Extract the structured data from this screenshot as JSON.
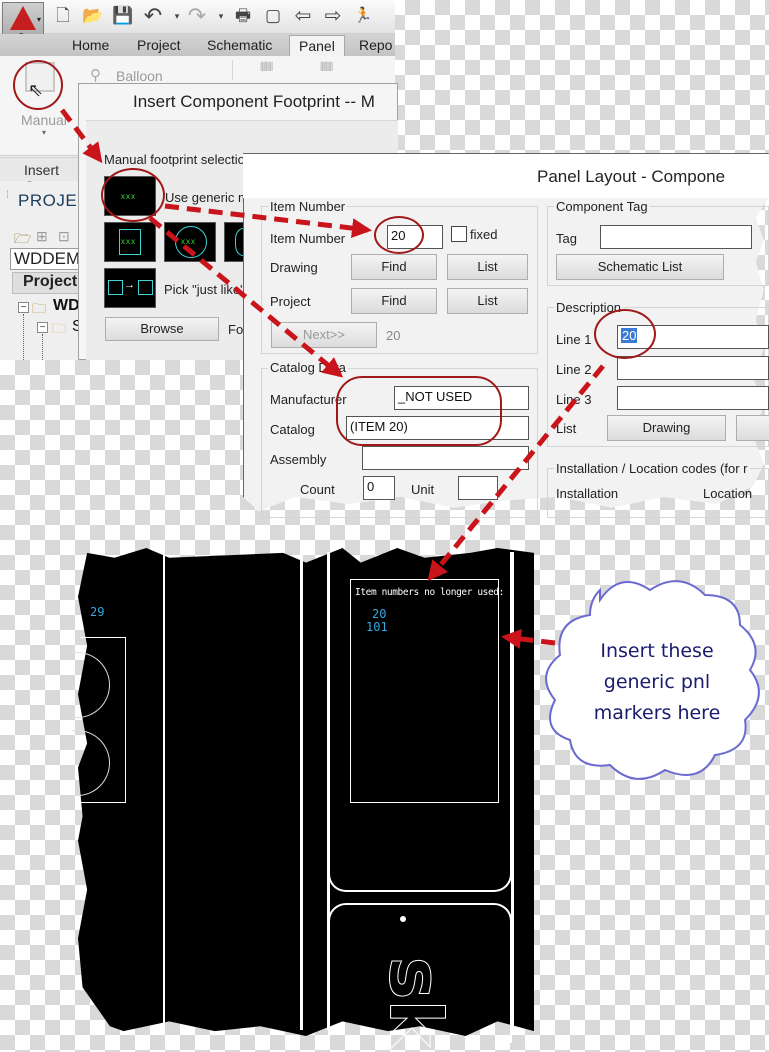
{
  "autocad": {
    "app_menu": {
      "logo": "autocad-logo",
      "sub_label": "E"
    },
    "quick_access": [
      {
        "name": "new-icon",
        "glyph": "🗋"
      },
      {
        "name": "open-icon",
        "glyph": "📂"
      },
      {
        "name": "save-icon",
        "glyph": "💾"
      },
      {
        "name": "undo-icon",
        "glyph": "↶"
      },
      {
        "name": "redo-icon",
        "glyph": "↷"
      },
      {
        "name": "print-icon",
        "glyph": "🖶"
      },
      {
        "name": "project-manager-icon",
        "glyph": "▢"
      },
      {
        "name": "back-icon",
        "glyph": "⇦"
      },
      {
        "name": "forward-icon",
        "glyph": "⇨"
      },
      {
        "name": "run-icon",
        "glyph": "🏃"
      }
    ],
    "tabs": [
      {
        "label": "Home"
      },
      {
        "label": "Project"
      },
      {
        "label": "Schematic"
      },
      {
        "label": "Panel",
        "active": true
      },
      {
        "label": "Repo"
      }
    ],
    "ribbon": {
      "manual_label": "Manual",
      "balloon_label": "Balloon",
      "panel_label": "Insert Co"
    },
    "project_pane": {
      "title": "PROJEC",
      "combo_value": "WDDEM",
      "header": "Project",
      "tree": [
        {
          "label": "WD",
          "bold": true
        },
        {
          "label": "S"
        }
      ]
    }
  },
  "footprint_dialog": {
    "title": "Insert Component Footprint -- M",
    "section_label": "Manual footprint selection or creation",
    "generic_label": "Use generic m",
    "thumb_text": "xxx",
    "pick_label": "Pick \"just like\"",
    "browse_label": "Browse",
    "fo_label": "Fo"
  },
  "panel_layout_dialog": {
    "title": "Panel Layout - Compone",
    "item_number_group": {
      "label": "Item Number",
      "item_number_label": "Item Number",
      "item_number_value": "20",
      "fixed_label": "fixed",
      "fixed_checked": false,
      "drawing_label": "Drawing",
      "project_label": "Project",
      "find_label": "Find",
      "list_label": "List",
      "next_label": "Next>>",
      "next_value": "20"
    },
    "catalog_group": {
      "label": "Catalog Data",
      "manufacturer_label": "Manufacturer",
      "manufacturer_value": "_NOT USED",
      "catalog_label": "Catalog",
      "catalog_value": "(ITEM 20)",
      "assembly_label": "Assembly",
      "assembly_value": "",
      "count_label": "Count",
      "count_value": "0",
      "unit_label": "Unit",
      "unit_value": ""
    },
    "component_tag_group": {
      "label": "Component Tag",
      "tag_label": "Tag",
      "tag_value": "",
      "schematic_list_label": "Schematic List"
    },
    "description_group": {
      "label": "Description",
      "line1_label": "Line 1",
      "line1_value": "20",
      "line2_label": "Line 2",
      "line2_value": "",
      "line3_label": "Line 3",
      "line3_value": "",
      "list_label": "List",
      "drawing_button": "Drawing"
    },
    "install_group": {
      "label": "Installation / Location codes  (for r",
      "installation_label": "Installation",
      "location_label": "Location"
    }
  },
  "cad_drawing": {
    "side_number": "29",
    "notes_title": "Item numbers no longer used:",
    "unused_numbers": [
      "20",
      "101"
    ],
    "logo_text": "sk"
  },
  "callout": {
    "lines": [
      "Insert these",
      "generic pnl",
      "markers here"
    ]
  },
  "colors": {
    "annotation_red": "#a01818",
    "arrow_red": "#c8141a",
    "cad_cyan": "#35a8e0",
    "footprint_green": "#2cdc2c",
    "cloud_border": "#6a6ad0",
    "cloud_text": "#1a1a6e",
    "selection_blue": "#3a7bd5"
  }
}
